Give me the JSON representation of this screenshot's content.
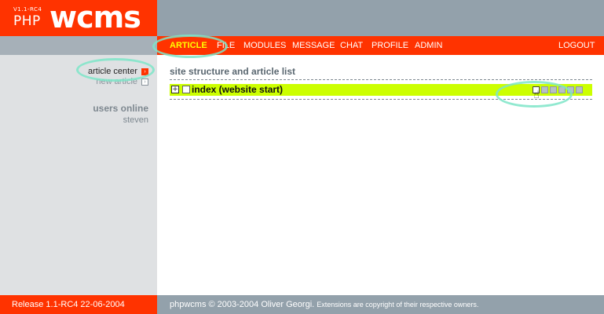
{
  "logo": {
    "version": "V1.1-RC4",
    "php": "PHP",
    "wcms": "wcms"
  },
  "nav": {
    "items": [
      "ARTICLE",
      "FILE",
      "MODULES",
      "MESSAGE",
      "CHAT",
      "PROFILE",
      "ADMIN"
    ],
    "logout": "LOGOUT",
    "active": "ARTICLE"
  },
  "sidebar": {
    "links": [
      {
        "label": "article center",
        "active": true
      },
      {
        "label": "new article",
        "active": false
      }
    ],
    "users_title": "users online",
    "users": [
      "steven"
    ]
  },
  "main": {
    "title": "site structure and article list",
    "row": {
      "expand_icon": "plus-box-icon",
      "page_icon": "document-icon",
      "title": "index (website start)"
    },
    "controls": [
      "edit-icon",
      "copy-icon",
      "move-up-icon",
      "move-down-icon",
      "add-icon",
      "properties-icon"
    ]
  },
  "footer": {
    "release": "Release 1.1-RC4 22-06-2004",
    "copyright": "phpwcms © 2003-2004 Oliver Georgi.",
    "extensions": "Extensions are copyright of their respective owners."
  },
  "colors": {
    "accent": "#ff3300",
    "grey": "#93a1ab",
    "sidebar": "#dfe1e3",
    "highlight_row": "#ccff00",
    "nav_active": "#ffff00"
  }
}
